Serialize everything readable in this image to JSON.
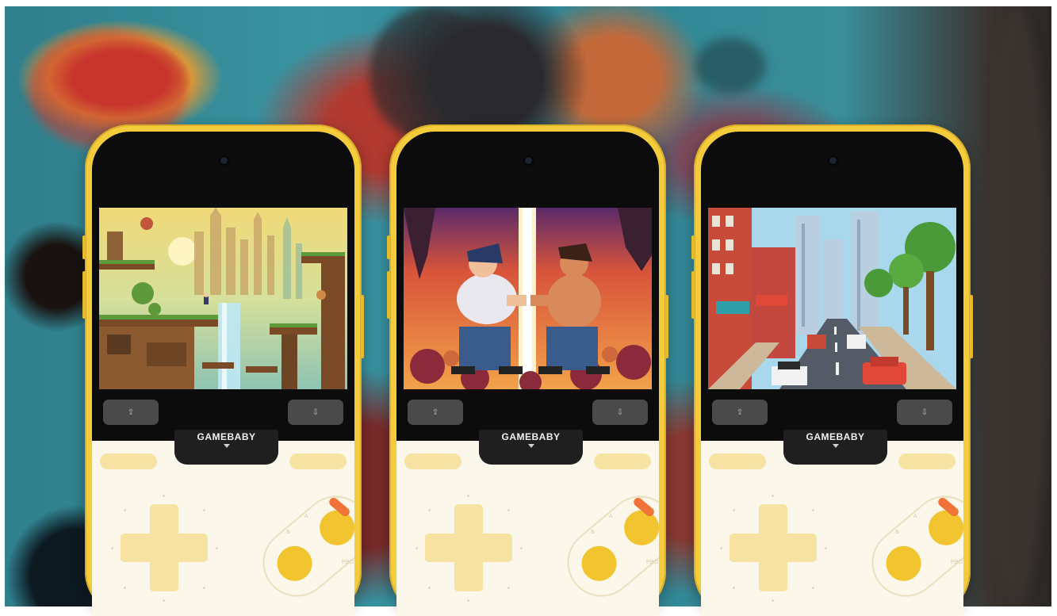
{
  "background": {
    "colors": {
      "teal": "#2f7f8c",
      "red": "#c0302a",
      "dark": "#2a2624"
    }
  },
  "phones": [
    {
      "brand": "GAMEBABY",
      "game_scene": "platformer",
      "upload_icon": "upload-icon",
      "download_icon": "download-icon"
    },
    {
      "brand": "GAMEBABY",
      "game_scene": "fighting",
      "upload_icon": "upload-icon",
      "download_icon": "download-icon"
    },
    {
      "brand": "GAMEBABY",
      "game_scene": "racing",
      "upload_icon": "upload-icon",
      "download_icon": "download-icon"
    }
  ],
  "controller": {
    "body_color": "#fbf7ea",
    "accent_color": "#f2c530",
    "dpad_color": "#f6e3a3",
    "shell_color": "#f4cb3b",
    "small_labels": [
      "B",
      "A",
      "PRO"
    ]
  }
}
